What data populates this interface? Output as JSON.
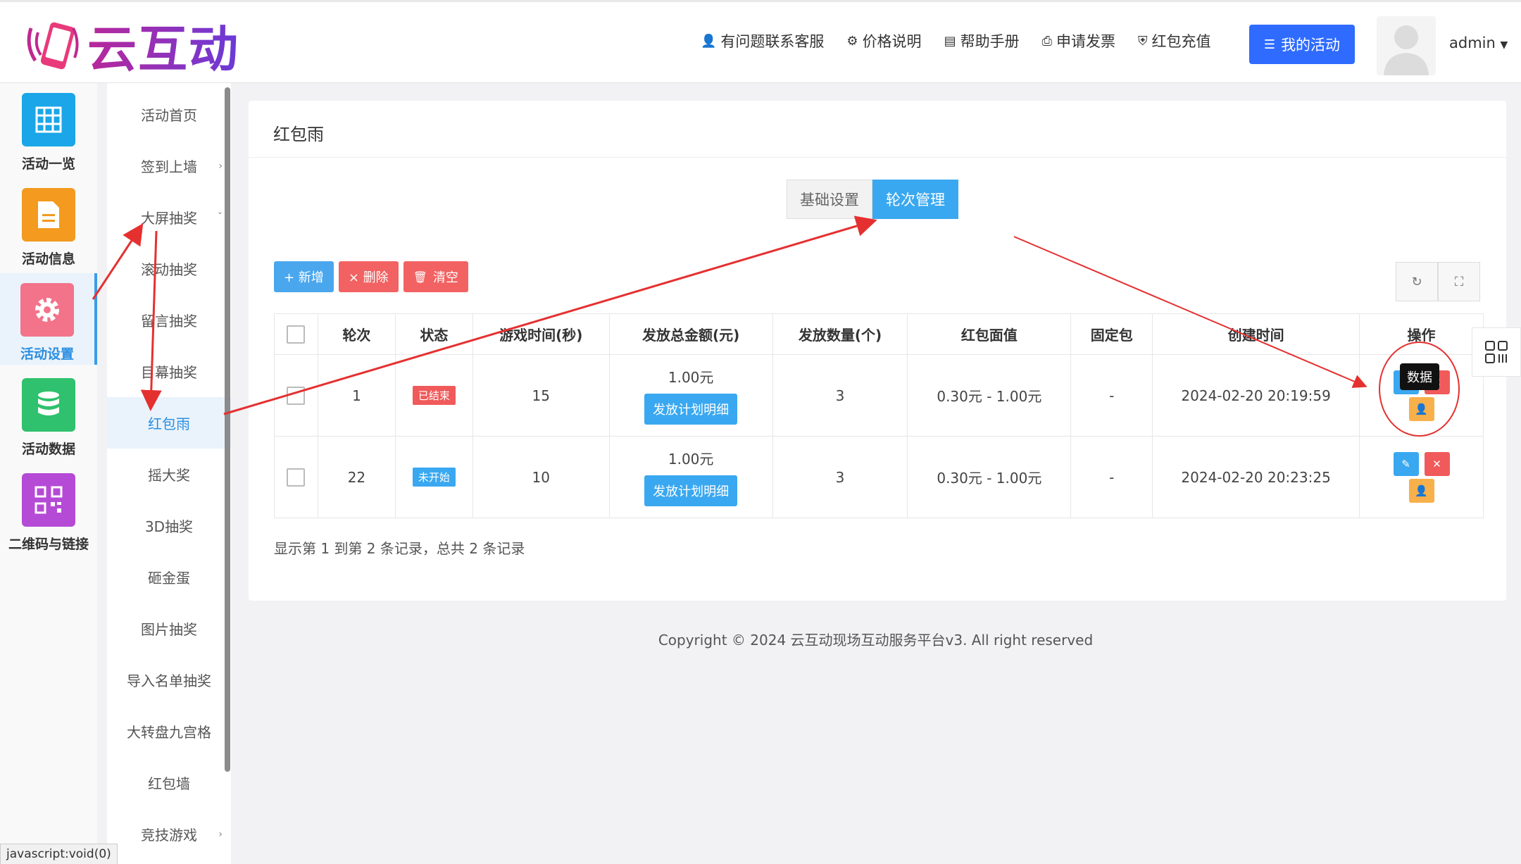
{
  "header": {
    "brand": "云互动",
    "nav": [
      {
        "icon": "user-plus-icon",
        "glyph": "👤",
        "label": "有问题联系客服"
      },
      {
        "icon": "gear-icon",
        "glyph": "⚙",
        "label": "价格说明"
      },
      {
        "icon": "book-icon",
        "glyph": "▤",
        "label": "帮助手册"
      },
      {
        "icon": "printer-icon",
        "glyph": "⎙",
        "label": "申请发票"
      },
      {
        "icon": "shield-icon",
        "glyph": "⛨",
        "label": "红包充值"
      }
    ],
    "my_activity": "我的活动",
    "user": "admin"
  },
  "iconbar": [
    {
      "label": "活动一览",
      "color": "#1aa6e8"
    },
    {
      "label": "活动信息",
      "color": "#f39a1f"
    },
    {
      "label": "活动设置",
      "color": "#f2738a"
    },
    {
      "label": "活动数据",
      "color": "#2fc16d"
    },
    {
      "label": "二维码与链接",
      "color": "#b54ad6"
    }
  ],
  "submenu": [
    {
      "label": "活动首页"
    },
    {
      "label": "签到上墙",
      "chev": "›"
    },
    {
      "label": "大屏抽奖",
      "chev": "ˇ"
    },
    {
      "label": "滚动抽奖"
    },
    {
      "label": "留言抽奖"
    },
    {
      "label": "目幕抽奖"
    },
    {
      "label": "红包雨"
    },
    {
      "label": "摇大奖"
    },
    {
      "label": "3D抽奖"
    },
    {
      "label": "砸金蛋"
    },
    {
      "label": "图片抽奖"
    },
    {
      "label": "导入名单抽奖"
    },
    {
      "label": "大转盘九宫格"
    },
    {
      "label": "红包墙"
    },
    {
      "label": "竞技游戏",
      "chev": "›"
    }
  ],
  "page": {
    "title": "红包雨",
    "tabs": [
      "基础设置",
      "轮次管理"
    ],
    "buttons": {
      "add": "+ 新增",
      "delete": "× 删除",
      "clear": "清空"
    },
    "columns": [
      "轮次",
      "状态",
      "游戏时间(秒)",
      "发放总金额(元)",
      "发放数量(个)",
      "红包面值",
      "固定包",
      "创建时间",
      "操作"
    ],
    "rows": [
      {
        "round": "1",
        "status": "已结束",
        "time": "15",
        "amount": "1.00元",
        "plan": "发放计划明细",
        "count": "3",
        "face": "0.30元 - 1.00元",
        "fixed": "-",
        "created": "2024-02-20 20:19:59"
      },
      {
        "round": "22",
        "status": "未开始",
        "time": "10",
        "amount": "1.00元",
        "plan": "发放计划明细",
        "count": "3",
        "face": "0.30元 - 1.00元",
        "fixed": "-",
        "created": "2024-02-20 20:23:25"
      }
    ],
    "tooltip": "数据",
    "records": "显示第 1 到第 2 条记录，总共 2 条记录"
  },
  "footer": "Copyright © 2024 云互动现场互动服务平台v3. All right reserved",
  "statusbar": "javascript:void(0)"
}
